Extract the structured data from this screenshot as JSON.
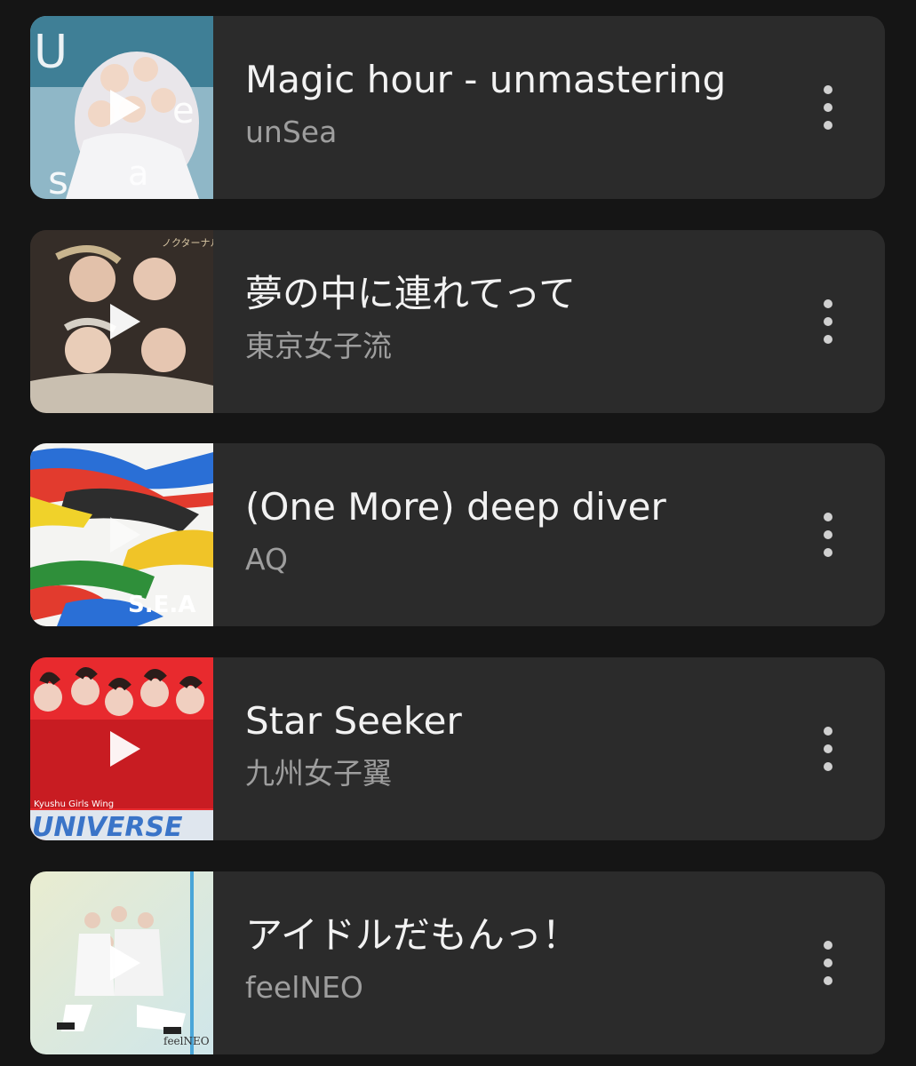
{
  "tracks": [
    {
      "title": "Magic hour - unmastering",
      "artist": "unSea",
      "art_text": "Under the Sea",
      "play_icon": "play-icon",
      "more_icon": "more-vertical-icon"
    },
    {
      "title": "夢の中に連れてって",
      "artist": "東京女子流",
      "art_text": "ノクターナル",
      "play_icon": "play-icon",
      "more_icon": "more-vertical-icon"
    },
    {
      "title": "(One More) deep diver",
      "artist": "AQ",
      "art_text": "S.E.A",
      "play_icon": "play-icon",
      "more_icon": "more-vertical-icon"
    },
    {
      "title": "Star Seeker",
      "artist": "九州女子翼",
      "art_text": "UNIVERSE",
      "art_subtext": "Kyushu Girls Wing",
      "play_icon": "play-icon",
      "more_icon": "more-vertical-icon"
    },
    {
      "title": "アイドルだもんっ！",
      "artist": "feelNEO",
      "art_text": "feelNEO",
      "play_icon": "play-icon",
      "more_icon": "more-vertical-icon"
    }
  ]
}
